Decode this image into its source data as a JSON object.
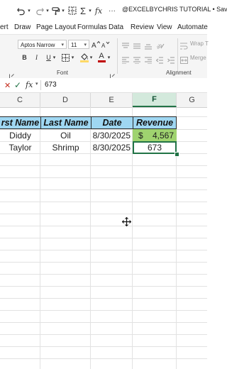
{
  "title_bar": {
    "title": "@EXCELBYCHRIS TUTORIAL • Saved",
    "autosum_glyph": "Σ",
    "fx_glyph": "fx",
    "more_glyph": "···"
  },
  "menu_tabs": [
    "ert",
    "Draw",
    "Page Layout",
    "Formulas",
    "Data",
    "Review",
    "View",
    "Automate"
  ],
  "ribbon": {
    "font_name": "Aptos Narrow",
    "font_size": "11",
    "bold": "B",
    "italic": "I",
    "underline": "U",
    "font_color_glyph": "A",
    "font_group_label": "Font",
    "alignment_group_label": "Alignment",
    "wrap_text_label": "Wrap T",
    "merge_label": "Merge",
    "font_color_accent": "#c00000",
    "fill_color_accent": "#ffd966"
  },
  "formula_bar": {
    "cancel_glyph": "✕",
    "enter_glyph": "✓",
    "fx_glyph": "fx",
    "value": "673"
  },
  "sheet": {
    "columns": [
      "C",
      "D",
      "E",
      "F",
      "G"
    ],
    "selected_column": "F",
    "header_row": [
      "rst Name",
      "Last Name",
      "Date",
      "Revenue"
    ],
    "rows": [
      {
        "first": "Diddy",
        "last": "Oil",
        "date": "8/30/2025",
        "currency": "$",
        "revenue": "4,567"
      },
      {
        "first": "Taylor",
        "last": "Shrimp",
        "date": "8/30/2025",
        "currency": "",
        "revenue": "673"
      }
    ],
    "header_fill": "#9fd7f2",
    "revenue_fill": "#9fd36f",
    "selection_color": "#217346"
  }
}
